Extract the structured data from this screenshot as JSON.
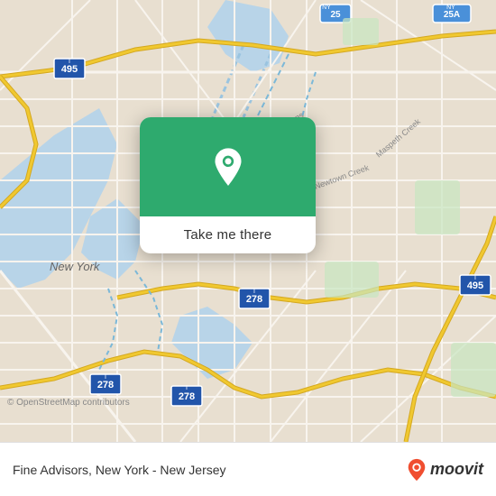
{
  "map": {
    "attribution": "© OpenStreetMap contributors",
    "bg_color": "#e8dfd0",
    "water_color": "#b8d4e8",
    "road_color": "#f5f0e8",
    "highway_color": "#f0c830",
    "highway_stroke": "#d4a820"
  },
  "popup": {
    "button_label": "Take me there",
    "bg_color": "#2eaa6e",
    "pin_color": "white"
  },
  "footer": {
    "place_name": "Fine Advisors, New York - New Jersey",
    "moovit_label": "moovit",
    "pin_color": "#f04e30"
  }
}
